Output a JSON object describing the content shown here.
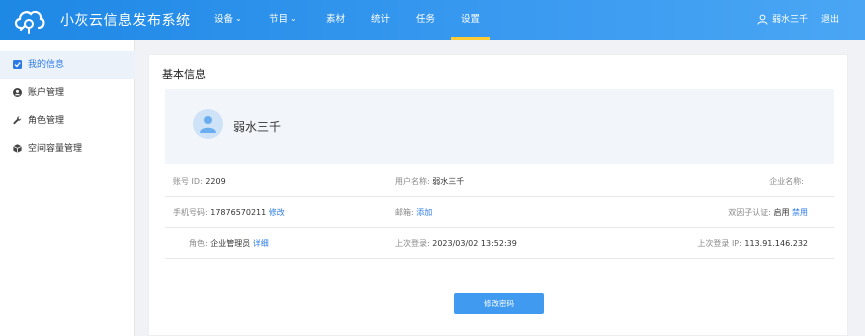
{
  "header": {
    "app_title": "小灰云信息发布系统",
    "nav": [
      {
        "label": "设备",
        "chevron": true,
        "active": false
      },
      {
        "label": "节目",
        "chevron": true,
        "active": false
      },
      {
        "label": "素材",
        "chevron": false,
        "active": false
      },
      {
        "label": "统计",
        "chevron": false,
        "active": false
      },
      {
        "label": "任务",
        "chevron": false,
        "active": false
      },
      {
        "label": "设置",
        "chevron": false,
        "active": true
      }
    ],
    "user_name": "弱水三千",
    "logout_label": "退出"
  },
  "sidebar": {
    "items": [
      {
        "label": "我的信息",
        "icon": "checkbox-icon",
        "active": true
      },
      {
        "label": "账户管理",
        "icon": "user-circle-icon",
        "active": false
      },
      {
        "label": "角色管理",
        "icon": "wrench-icon",
        "active": false
      },
      {
        "label": "空间容量管理",
        "icon": "cube-icon",
        "active": false
      }
    ]
  },
  "main": {
    "title": "基本信息",
    "profile_name": "弱水三千",
    "rows": [
      {
        "account_id_label": "账号 ID:",
        "account_id_value": "2209",
        "username_label": "用户名称:",
        "username_value": "弱水三千",
        "company_label": "企业名称:"
      },
      {
        "phone_label": "手机号码:",
        "phone_value": "17876570211",
        "phone_action": "修改",
        "email_label": "邮箱:",
        "email_action": "添加",
        "twofa_label": "双因子认证:",
        "twofa_value": "启用",
        "twofa_action": "禁用"
      },
      {
        "role_label": "角色:",
        "role_value": "企业管理员",
        "role_action": "详细",
        "last_login_label": "上次登录:",
        "last_login_value": "2023/03/02 13:52:39",
        "last_ip_label": "上次登录 IP:",
        "last_ip_value": "113.91.146.232"
      }
    ],
    "change_password_label": "修改密码"
  },
  "colors": {
    "header_start": "#1e88e5",
    "header_end": "#4aa6f4",
    "active_tab_underline": "#ffcc33",
    "link": "#2c7be5",
    "button": "#3f9af0"
  }
}
